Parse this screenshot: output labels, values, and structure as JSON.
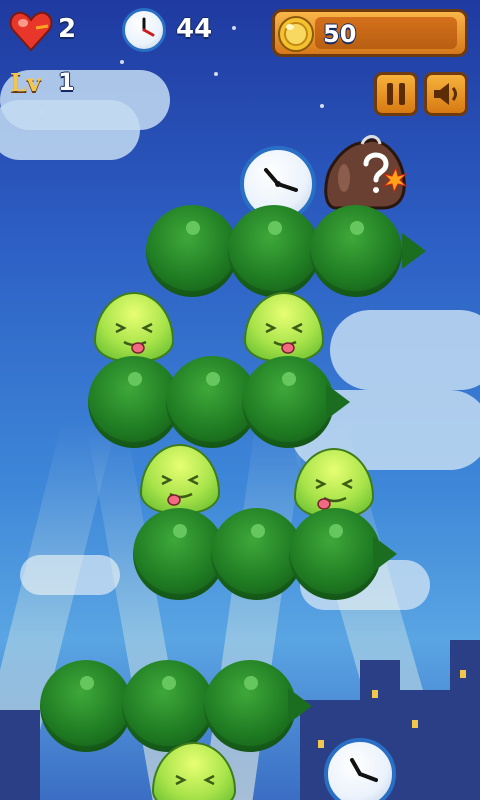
{
  "hud": {
    "lives": {
      "icon": "heart-icon",
      "value": "2",
      "color": "#e8372a"
    },
    "timer": {
      "icon": "clock-icon",
      "value": "44"
    },
    "coins": {
      "icon": "coin-icon",
      "value": "50",
      "color": "#f4c230"
    },
    "level": {
      "label": "Lv",
      "value": "1"
    },
    "buttons": {
      "pause": {
        "icon": "pause-icon"
      },
      "sound": {
        "icon": "speaker-icon"
      }
    }
  },
  "items": {
    "clock_top": {
      "icon": "clock-icon"
    },
    "mystery_bag": {
      "icon": "mystery-bag-icon"
    },
    "clock_bottom": {
      "icon": "clock-icon"
    }
  },
  "colors": {
    "pea_green": "#1f7b22",
    "blob_yellow_green": "#a8e34a",
    "ui_orange": "#e8941e",
    "sky_blue": "#2d5fc4"
  }
}
